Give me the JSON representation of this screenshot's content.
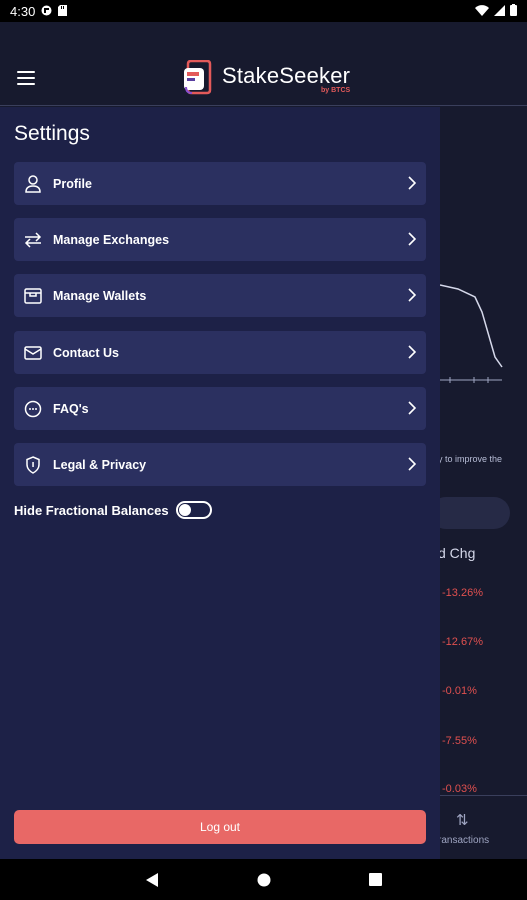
{
  "status_bar": {
    "time": "4:30"
  },
  "header": {
    "brand_name": "StakeSeeker",
    "brand_by": "by BTCS"
  },
  "drawer": {
    "title": "Settings",
    "items": [
      {
        "label": "Profile",
        "icon": "person-icon"
      },
      {
        "label": "Manage Exchanges",
        "icon": "swap-arrows-icon"
      },
      {
        "label": "Manage Wallets",
        "icon": "wallet-icon"
      },
      {
        "label": "Contact Us",
        "icon": "mail-icon"
      },
      {
        "label": "FAQ's",
        "icon": "chat-dots-icon"
      },
      {
        "label": "Legal & Privacy",
        "icon": "shield-icon"
      }
    ],
    "toggle_label": "Hide Fractional Balances",
    "toggle_on": false,
    "logout_label": "Log out"
  },
  "background": {
    "note": "y to improve the",
    "column_header": "d Chg",
    "values": [
      "-13.26%",
      "-12.67%",
      "-0.01%",
      "-7.55%",
      "-0.03%"
    ],
    "tab_label": "ransactions"
  },
  "colors": {
    "accent": "#e86866",
    "drawer_bg": "#1d2147",
    "item_bg": "#2b3060",
    "negative": "#e0504f"
  }
}
